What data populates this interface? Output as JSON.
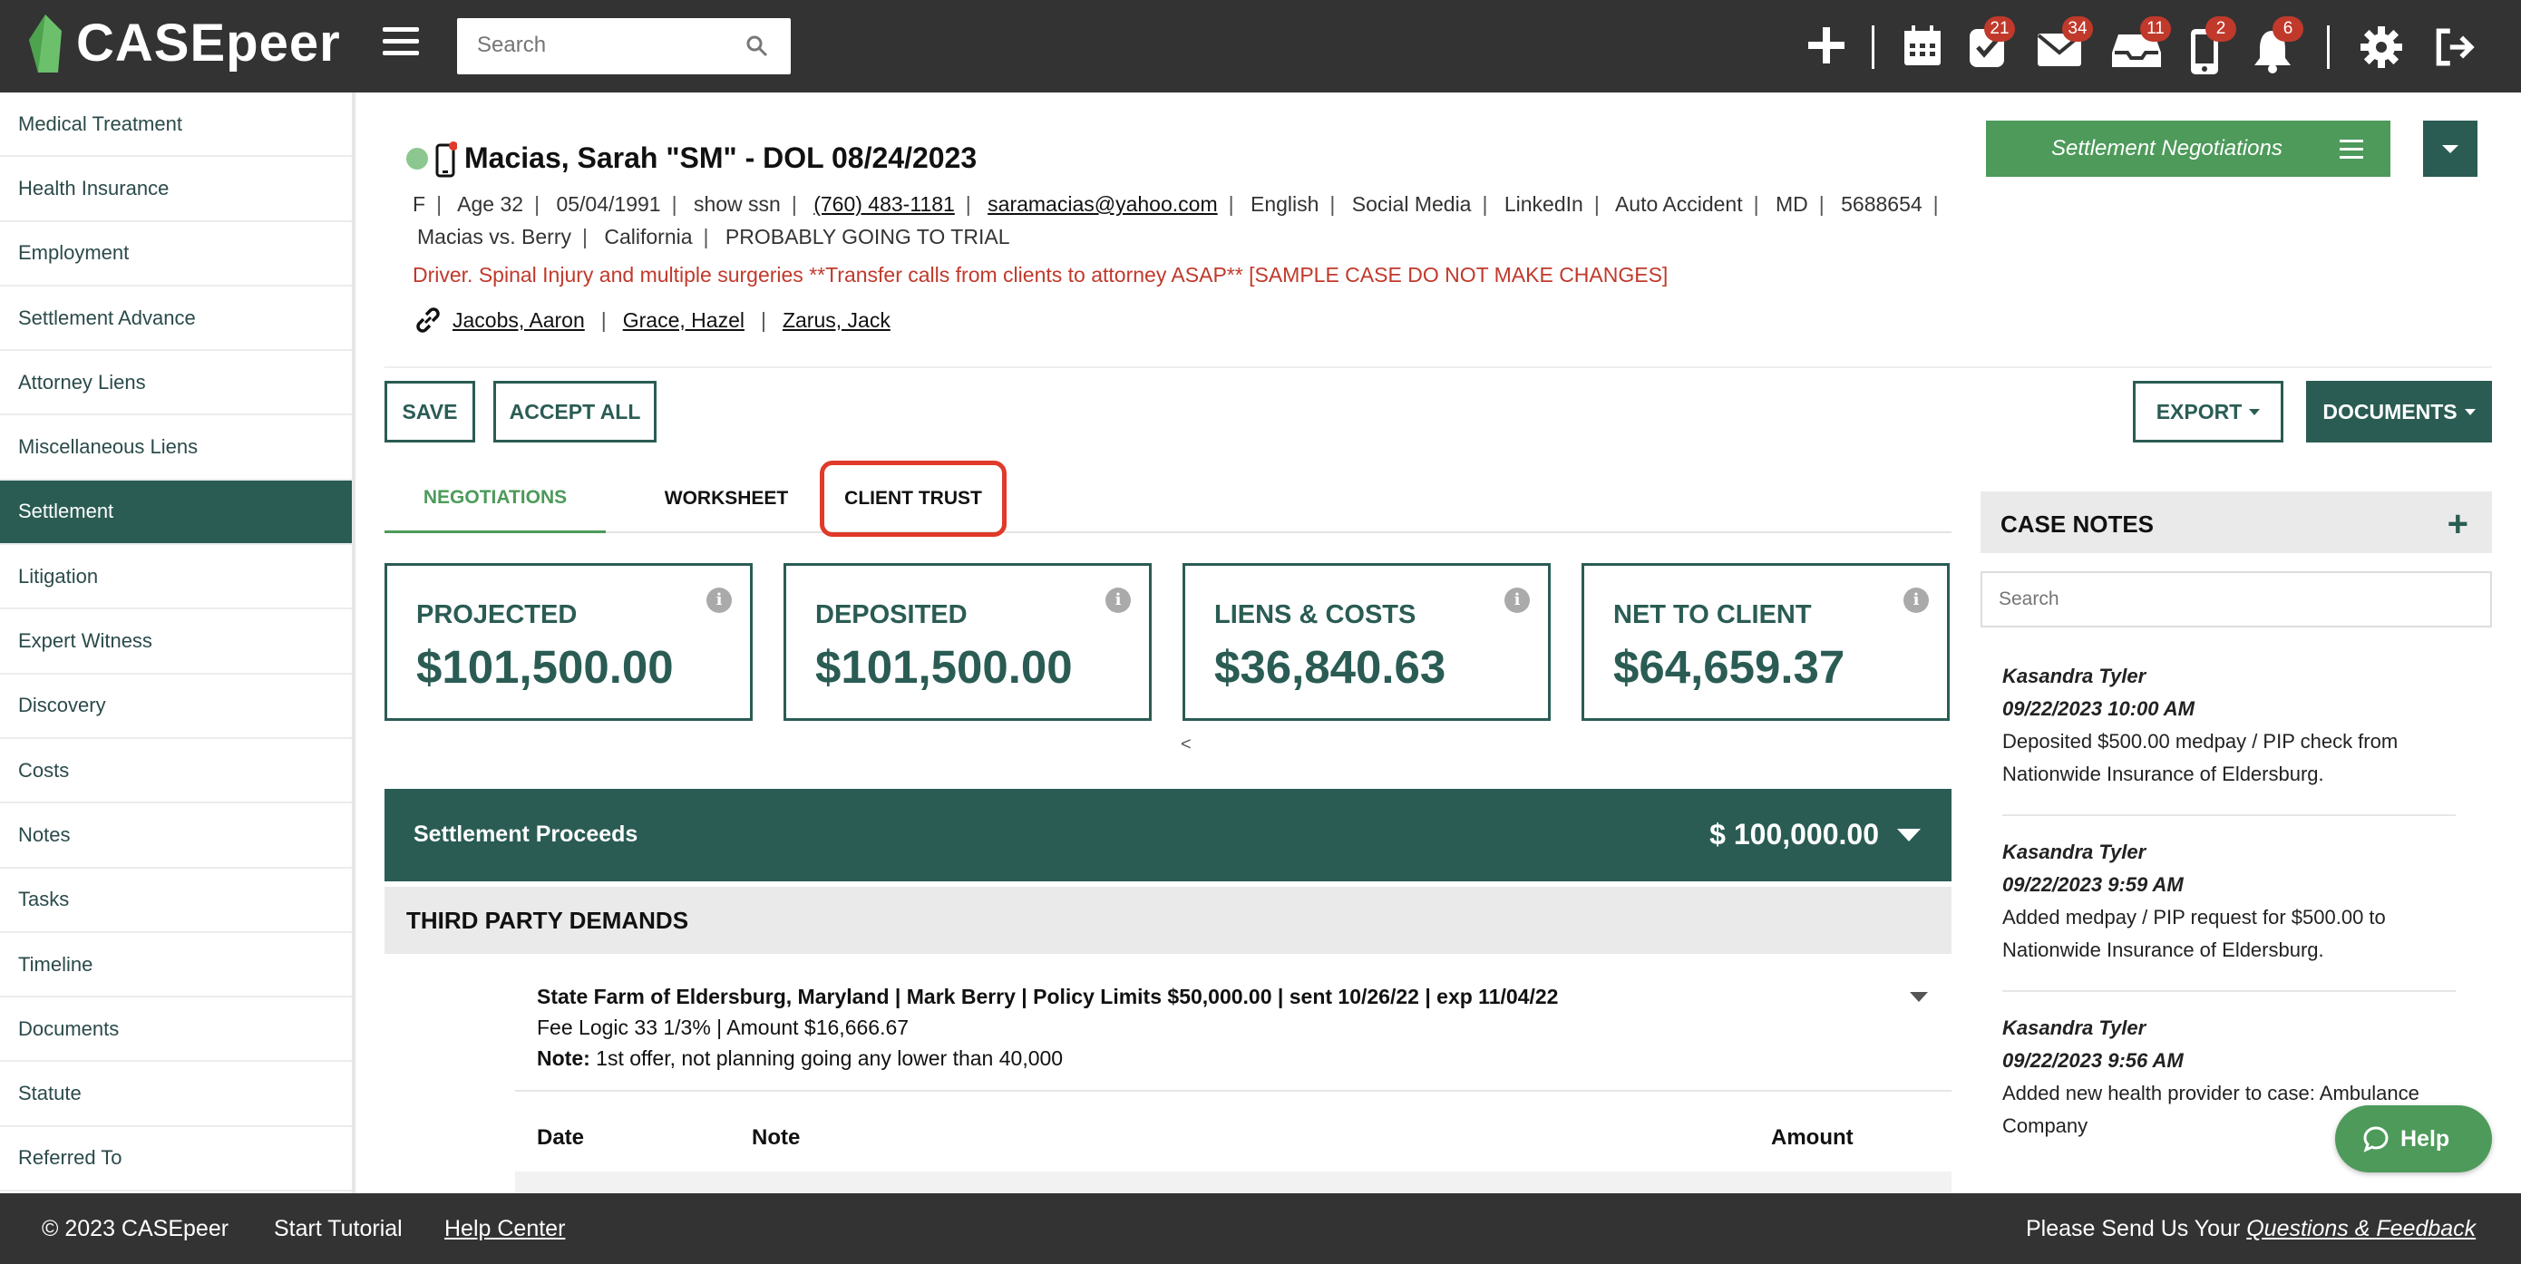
{
  "app": {
    "name": "CASEpeer"
  },
  "search": {
    "placeholder": "Search"
  },
  "top_badges": {
    "tasks": "21",
    "mail": "34",
    "inbox": "11",
    "sms": "2",
    "alerts": "6"
  },
  "sidebar": {
    "items": [
      {
        "label": "Medical Treatment"
      },
      {
        "label": "Health Insurance"
      },
      {
        "label": "Employment"
      },
      {
        "label": "Settlement Advance"
      },
      {
        "label": "Attorney Liens"
      },
      {
        "label": "Miscellaneous Liens"
      },
      {
        "label": "Settlement"
      },
      {
        "label": "Litigation"
      },
      {
        "label": "Expert Witness"
      },
      {
        "label": "Discovery"
      },
      {
        "label": "Costs"
      },
      {
        "label": "Notes"
      },
      {
        "label": "Tasks"
      },
      {
        "label": "Timeline"
      },
      {
        "label": "Documents"
      },
      {
        "label": "Statute"
      },
      {
        "label": "Referred To"
      }
    ]
  },
  "client": {
    "title": "Macias, Sarah \"SM\" - DOL 08/24/2023",
    "meta1": [
      "F",
      "Age 32",
      "05/04/1991",
      "show ssn",
      "(760) 483-1181",
      "saramacias@yahoo.com",
      "English",
      "Social Media",
      "LinkedIn",
      "Auto Accident",
      "MD",
      "5688654"
    ],
    "meta2": [
      "Macias vs. Berry",
      "California",
      "PROBABLY GOING TO TRIAL"
    ],
    "alert": "Driver. Spinal Injury and multiple surgeries **Transfer calls from clients to attorney ASAP** [SAMPLE CASE DO NOT MAKE CHANGES]",
    "links": [
      "Jacobs, Aaron",
      "Grace, Hazel",
      "Zarus, Jack"
    ]
  },
  "status": {
    "label": "Settlement Negotiations"
  },
  "actions": {
    "save": "SAVE",
    "accept_all": "ACCEPT ALL",
    "export": "EXPORT",
    "documents": "DOCUMENTS"
  },
  "tabs": [
    {
      "label": "NEGOTIATIONS"
    },
    {
      "label": "WORKSHEET"
    },
    {
      "label": "CLIENT TRUST"
    }
  ],
  "cards": [
    {
      "label": "PROJECTED",
      "value": "$101,500.00"
    },
    {
      "label": "DEPOSITED",
      "value": "$101,500.00"
    },
    {
      "label": "LIENS & COSTS",
      "value": "$36,840.63"
    },
    {
      "label": "NET TO CLIENT",
      "value": "$64,659.37"
    }
  ],
  "pager": "<",
  "proceeds": {
    "label": "Settlement Proceeds",
    "amount": "$ 100,000.00"
  },
  "third_party": {
    "title": "THIRD PARTY DEMANDS",
    "line1": "State Farm of Eldersburg, Maryland | Mark Berry | Policy Limits $50,000.00 | sent 10/26/22 | exp 11/04/22",
    "line2": "Fee Logic 33 1/3% | Amount $16,666.67",
    "note_label": "Note:",
    "note_text": " 1st offer, not planning going any lower than 40,000",
    "columns": [
      "Date",
      "Note",
      "Amount"
    ]
  },
  "case_notes": {
    "title": "CASE NOTES",
    "search_placeholder": "Search",
    "notes": [
      {
        "author": "Kasandra Tyler",
        "time": "09/22/2023 10:00 AM",
        "text": "Deposited $500.00 medpay / PIP check from Nationwide Insurance of Eldersburg."
      },
      {
        "author": "Kasandra Tyler",
        "time": "09/22/2023 9:59 AM",
        "text": "Added medpay / PIP request for $500.00 to Nationwide Insurance of Eldersburg."
      },
      {
        "author": "Kasandra Tyler",
        "time": "09/22/2023 9:56 AM",
        "text": "Added new health provider to case: Ambulance Company"
      }
    ]
  },
  "help": {
    "label": "Help"
  },
  "footer": {
    "copyright": "© 2023 CASEpeer",
    "tutorial": "Start Tutorial",
    "help_center": "Help Center",
    "feedback_prefix": "Please Send Us Your ",
    "feedback_link": "Questions & Feedback"
  },
  "colors": {
    "brand": "#2a5c54",
    "accent": "#4d9a5a",
    "alert": "#c0392b",
    "topbar": "#333333"
  }
}
